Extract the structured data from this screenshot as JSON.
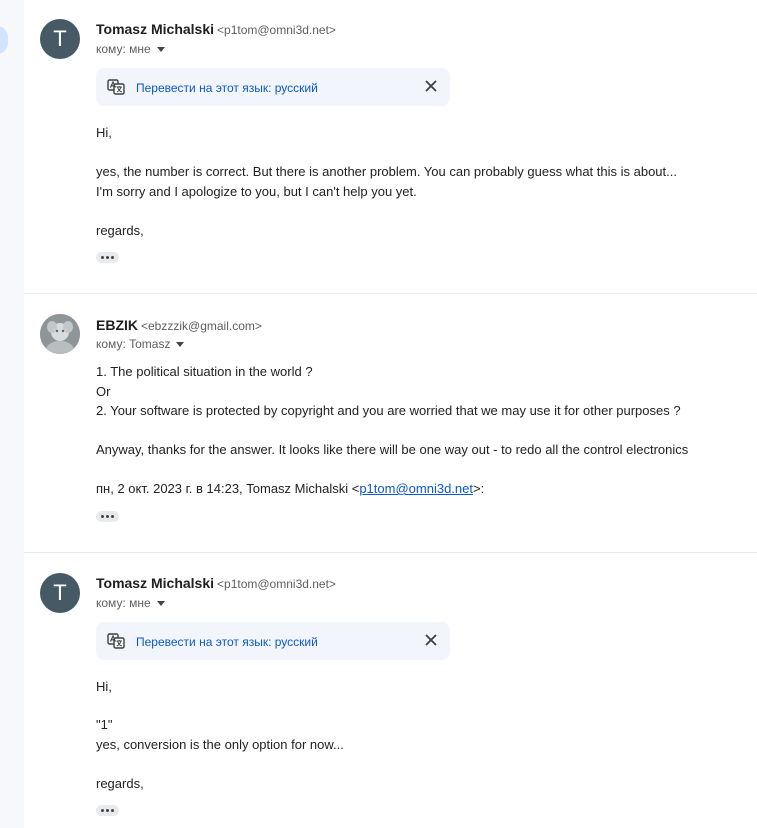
{
  "messages": [
    {
      "avatar_letter": "T",
      "sender_name": "Tomasz Michalski",
      "sender_email": "<p1tom@omni3d.net>",
      "to_line": "кому: мне",
      "translate_label": "Перевести на этот язык: русский",
      "body": {
        "greeting": "Hi,",
        "line1": "yes, the number is correct. But there is another problem. You can probably guess what this is about...",
        "line2": "I'm sorry and I apologize to you, but I can't help you yet.",
        "closing": "regards,"
      }
    },
    {
      "sender_name": "EBZIK",
      "sender_email": "<ebzzzik@gmail.com>",
      "to_line": "кому: Tomasz",
      "body": {
        "line1": "1. The political situation in the world ?",
        "line2": "Or",
        "line3": "2. Your software is protected by copyright and you are worried that we may use it for other purposes ?",
        "line4": "Anyway, thanks for the answer. It looks like there will be one way out - to redo all the control electronics",
        "quote_prefix": "пн, 2 окт. 2023 г. в 14:23, Tomasz Michalski <",
        "quote_link": "p1tom@omni3d.net",
        "quote_suffix": ">:"
      }
    },
    {
      "avatar_letter": "T",
      "sender_name": "Tomasz Michalski",
      "sender_email": "<p1tom@omni3d.net>",
      "to_line": "кому: мне",
      "translate_label": "Перевести на этот язык: русский",
      "body": {
        "greeting": "Hi,",
        "line1": "\"1\"",
        "line2": "yes, conversion is the only option for now...",
        "closing": "regards,"
      }
    }
  ]
}
